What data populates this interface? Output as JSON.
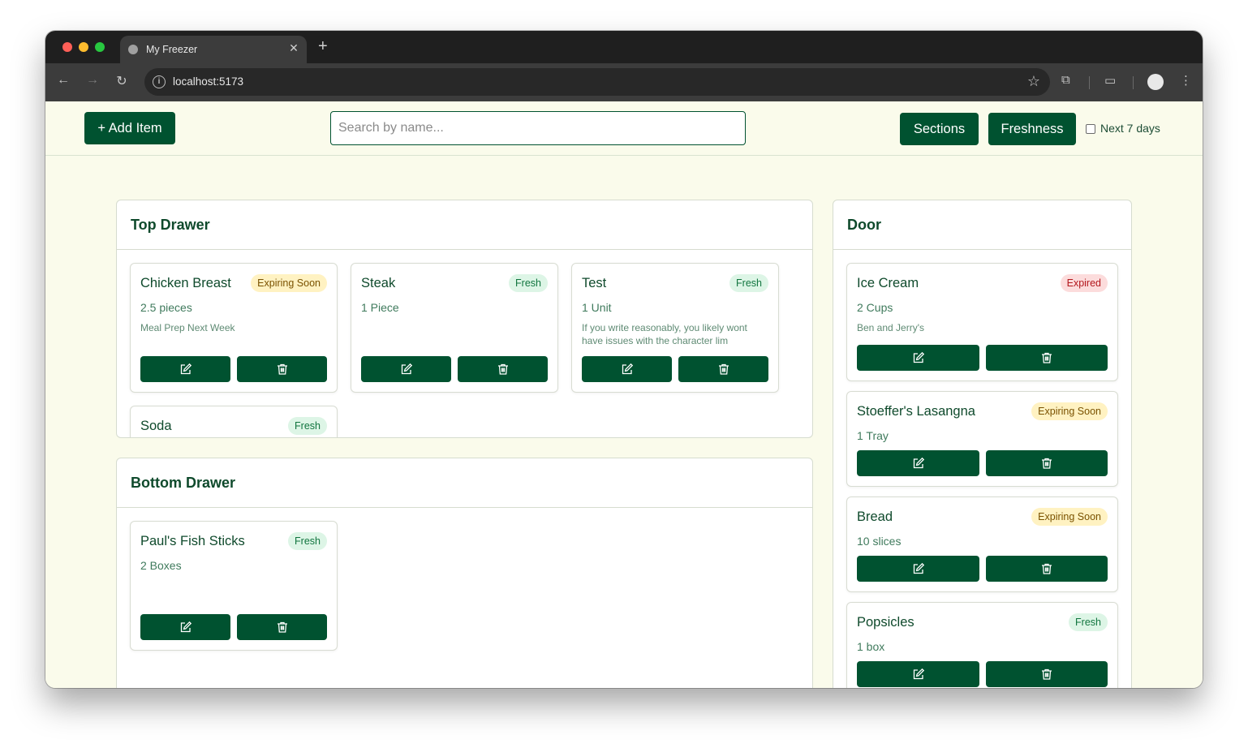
{
  "browser": {
    "tab_title": "My Freezer",
    "url": "localhost:5173"
  },
  "header": {
    "add_button": "+ Add Item",
    "search_placeholder": "Search by name...",
    "sections_button": "Sections",
    "freshness_button": "Freshness",
    "filter_label": "Next 7 days",
    "filter_checked": false
  },
  "colors": {
    "primary": "#005230",
    "page_background": "#fafbeb",
    "fresh_badge": "#ddf5e6",
    "expiring_badge": "#fff2c2",
    "expired_badge": "#fcdcdc"
  },
  "sections": [
    {
      "title": "Top Drawer",
      "items": [
        {
          "name": "Chicken Breast",
          "status": "Expiring Soon",
          "quantity": "2.5 pieces",
          "note": "Meal Prep Next Week"
        },
        {
          "name": "Steak",
          "status": "Fresh",
          "quantity": "1 Piece",
          "note": ""
        },
        {
          "name": "Test",
          "status": "Fresh",
          "quantity": "1 Unit",
          "note": "If you write reasonably, you likely wont have issues with the character lim"
        },
        {
          "name": "Soda",
          "status": "Fresh",
          "quantity": "",
          "note": ""
        }
      ]
    },
    {
      "title": "Bottom Drawer",
      "items": [
        {
          "name": "Paul's Fish Sticks",
          "status": "Fresh",
          "quantity": "2 Boxes",
          "note": ""
        }
      ]
    },
    {
      "title": "Door",
      "items": [
        {
          "name": "Ice Cream",
          "status": "Expired",
          "quantity": "2 Cups",
          "note": "Ben and Jerry's"
        },
        {
          "name": "Stoeffer's Lasangna",
          "status": "Expiring Soon",
          "quantity": "1 Tray",
          "note": ""
        },
        {
          "name": "Bread",
          "status": "Expiring Soon",
          "quantity": "10 slices",
          "note": ""
        },
        {
          "name": "Popsicles",
          "status": "Fresh",
          "quantity": "1 box",
          "note": ""
        }
      ]
    }
  ],
  "icons": {
    "edit": "edit-icon",
    "delete": "trash-icon"
  }
}
